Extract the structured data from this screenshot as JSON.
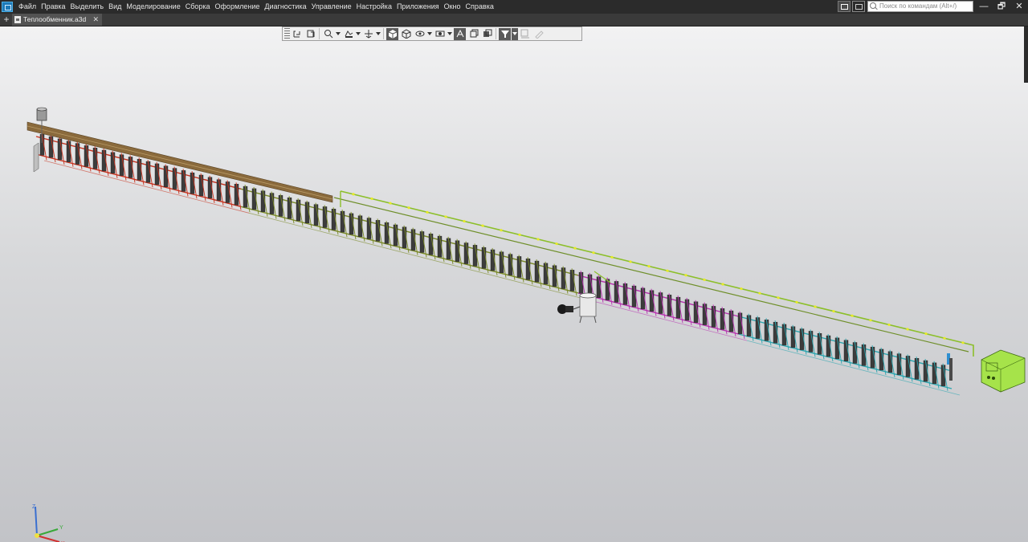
{
  "app": {
    "menu": [
      "Файл",
      "Правка",
      "Выделить",
      "Вид",
      "Моделирование",
      "Сборка",
      "Оформление",
      "Диагностика",
      "Управление",
      "Настройка",
      "Приложения",
      "Окно",
      "Справка"
    ],
    "search_placeholder": "Поиск по командам (Alt+/)",
    "window_controls": {
      "minimize": "—",
      "restore": "🗗",
      "close": "✕"
    }
  },
  "tabs": {
    "add": "+",
    "document": {
      "title": "Теплообменник.a3d",
      "close": "✕"
    }
  },
  "view_toolbar": {
    "buttons": [
      "orient-icon",
      "section-icon",
      "zoom-icon",
      "rotate-icon",
      "pan-icon",
      "shaded-icon",
      "wireframe-icon",
      "hidden-icon",
      "display-mode-icon",
      "perspective-icon",
      "copy-view-icon",
      "render-icon",
      "filter-icon",
      "dim-icon",
      "pen-icon"
    ],
    "active": [
      "shaded-icon",
      "perspective-icon",
      "filter-icon"
    ]
  },
  "viewport": {
    "axes": {
      "x": "X",
      "y": "Y",
      "z": "Z"
    },
    "colors": {
      "frame_red": "#c8321e",
      "frame_olive": "#7a8a26",
      "frame_magenta": "#b830b0",
      "frame_cyan": "#2aa6b0",
      "pipe_green": "#8cbf2a",
      "pipe_tan": "#8a6a3c",
      "unit_lime": "#a6e34a"
    }
  }
}
